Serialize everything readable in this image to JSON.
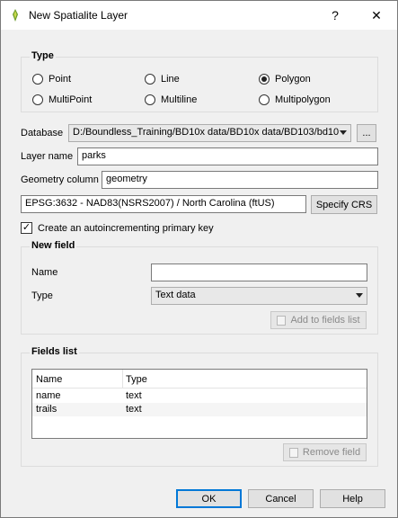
{
  "window": {
    "title": "New Spatialite Layer",
    "help_glyph": "?",
    "close_glyph": "✕"
  },
  "type_group": {
    "title": "Type",
    "options": [
      "Point",
      "Line",
      "Polygon",
      "MultiPoint",
      "Multiline",
      "Multipolygon"
    ],
    "selected": "Polygon"
  },
  "database": {
    "label": "Database",
    "value": "D:/Boundless_Training/BD10x data/BD10x data/BD103/bd10",
    "browse_label": "..."
  },
  "layer_name": {
    "label": "Layer name",
    "value": "parks"
  },
  "geometry_column": {
    "label": "Geometry column",
    "value": "geometry"
  },
  "crs": {
    "value": "EPSG:3632 - NAD83(NSRS2007) / North Carolina (ftUS)",
    "button_label": "Specify CRS"
  },
  "primary_key": {
    "label": "Create an autoincrementing primary key",
    "checked": true,
    "check_glyph": "✓"
  },
  "new_field": {
    "title": "New field",
    "name_label": "Name",
    "name_value": "",
    "type_label": "Type",
    "type_value": "Text data",
    "add_button_label": "Add to fields list"
  },
  "fields_list": {
    "title": "Fields list",
    "columns": [
      "Name",
      "Type"
    ],
    "rows": [
      {
        "name": "name",
        "type": "text"
      },
      {
        "name": "trails",
        "type": "text"
      }
    ],
    "remove_button_label": "Remove field"
  },
  "footer": {
    "ok_label": "OK",
    "cancel_label": "Cancel",
    "help_label": "Help"
  },
  "colors": {
    "accent": "#0078d7",
    "title_bg": "#ffffff",
    "dialog_bg": "#f0f0f0"
  }
}
